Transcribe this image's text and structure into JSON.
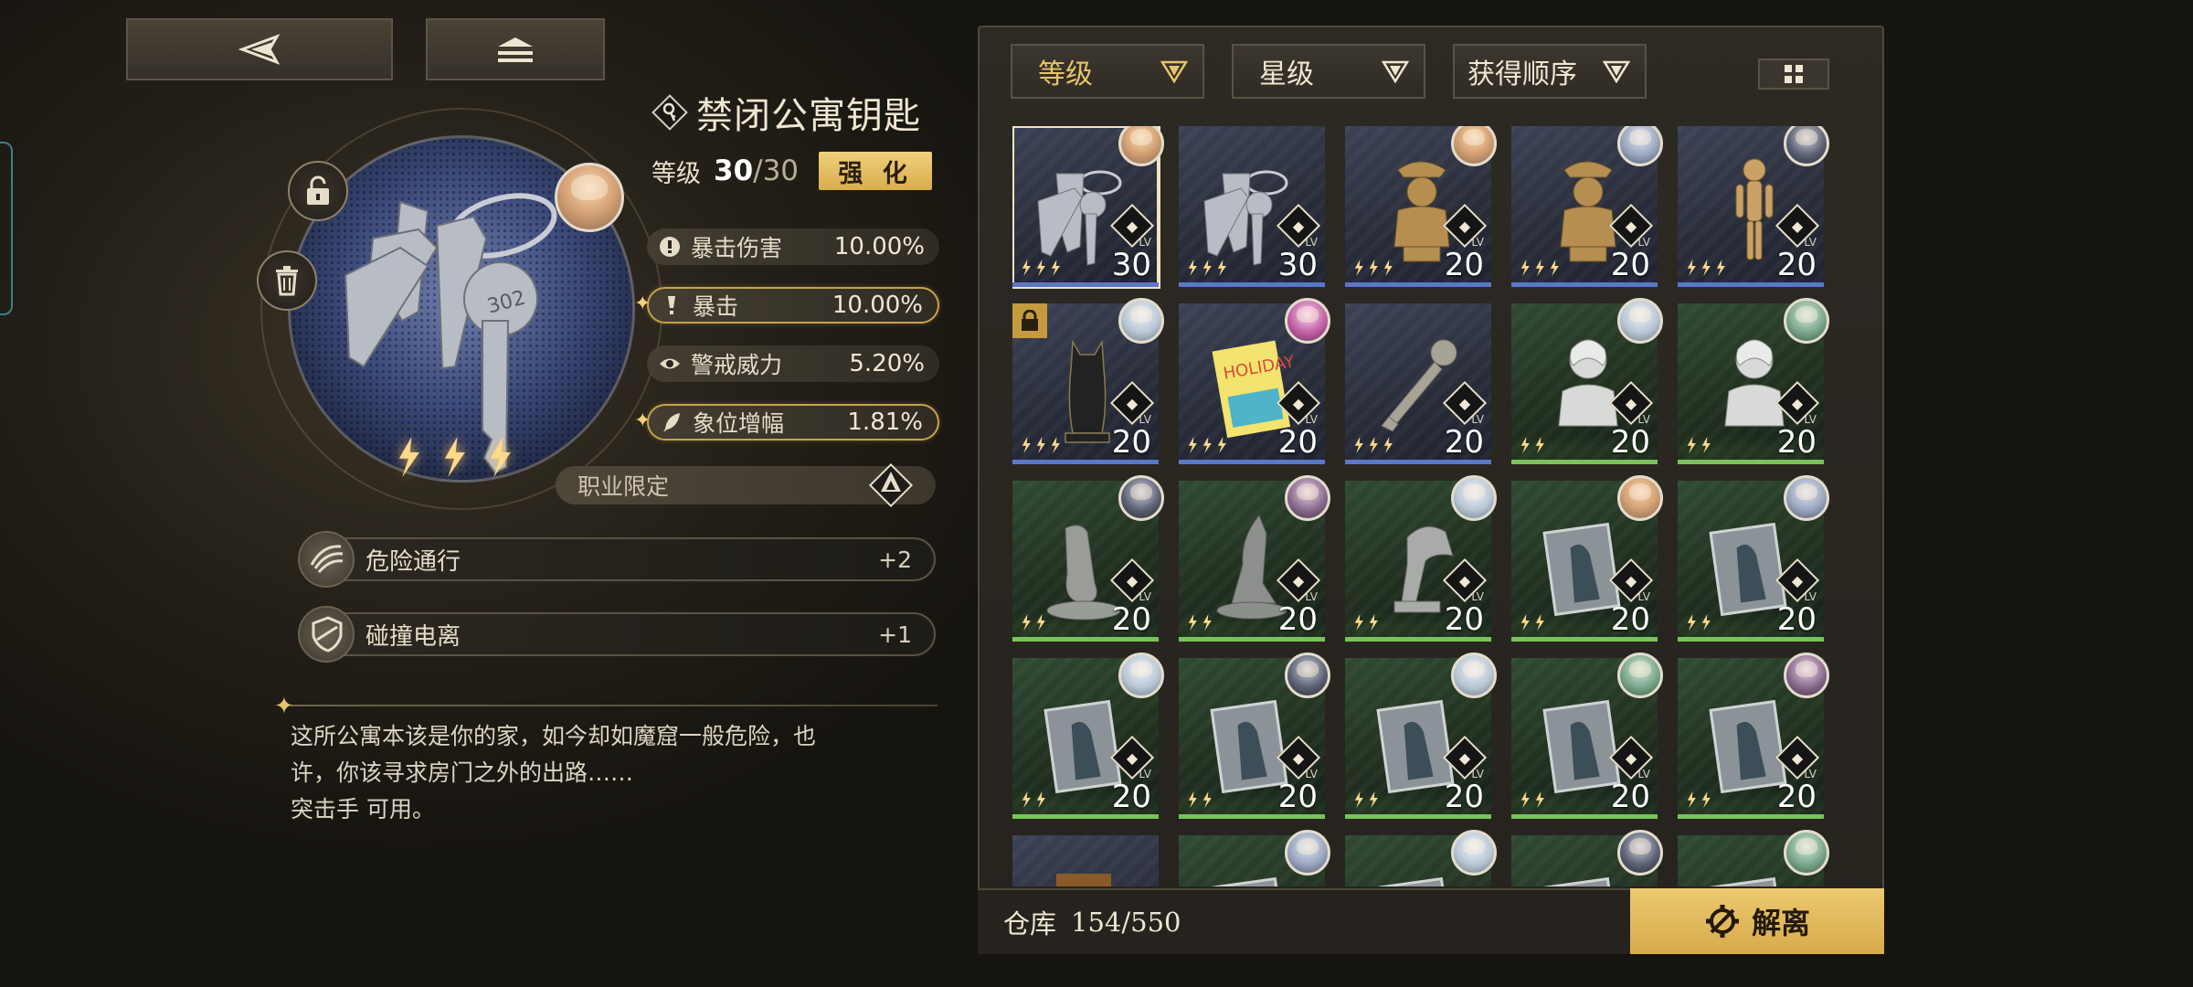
{
  "nav": {
    "back_icon": "back-arrow-icon",
    "home_icon": "stack-home-icon"
  },
  "item": {
    "name": "禁闭公寓钥匙",
    "level_label": "等级",
    "level": "30",
    "level_max": "/30",
    "enhance_label": "强 化",
    "rarity_stars": 3,
    "stats": [
      {
        "label": "暴击伤害",
        "value": "10.00%",
        "icon": "crit-damage-icon",
        "highlight": false
      },
      {
        "label": "暴击",
        "value": "10.00%",
        "icon": "crit-icon",
        "highlight": true
      },
      {
        "label": "警戒威力",
        "value": "5.20%",
        "icon": "alert-eye-icon",
        "highlight": false
      },
      {
        "label": "象位增幅",
        "value": "1.81%",
        "icon": "quill-icon",
        "highlight": true
      }
    ],
    "restriction_label": "职业限定",
    "skills": [
      {
        "name": "危险通行",
        "value": "+2"
      },
      {
        "name": "碰撞电离",
        "value": "+1"
      }
    ],
    "description": "这所公寓本该是你的家，如今却如魔窟一般危险，也\n许，你该寻求房门之外的出路……\n突击手 可用。"
  },
  "filters": [
    {
      "label": "等级",
      "active": true
    },
    {
      "label": "星级",
      "active": false
    },
    {
      "label": "获得顺序",
      "active": false
    }
  ],
  "inventory": {
    "lv_tag": "LV",
    "cards": [
      {
        "lv": "30",
        "stars": 3,
        "theme": "blue",
        "art": "keys",
        "avatar": "p1",
        "selected": true,
        "locked": false
      },
      {
        "lv": "30",
        "stars": 3,
        "theme": "blue",
        "art": "keys",
        "avatar": "",
        "selected": false,
        "locked": false
      },
      {
        "lv": "20",
        "stars": 3,
        "theme": "blue",
        "art": "bust-gold",
        "avatar": "p1",
        "selected": false,
        "locked": false
      },
      {
        "lv": "20",
        "stars": 3,
        "theme": "blue",
        "art": "bust-gold",
        "avatar": "p2",
        "selected": false,
        "locked": false
      },
      {
        "lv": "20",
        "stars": 3,
        "theme": "blue",
        "art": "mannequin",
        "avatar": "p6",
        "selected": false,
        "locked": false
      },
      {
        "lv": "20",
        "stars": 3,
        "theme": "blue",
        "art": "cat",
        "avatar": "p4",
        "selected": false,
        "locked": true
      },
      {
        "lv": "20",
        "stars": 3,
        "theme": "blue",
        "art": "book",
        "avatar": "p3",
        "selected": false,
        "locked": false
      },
      {
        "lv": "20",
        "stars": 3,
        "theme": "blue",
        "art": "key-ornate",
        "avatar": "",
        "selected": false,
        "locked": false
      },
      {
        "lv": "20",
        "stars": 2,
        "theme": "green",
        "art": "bust-white",
        "avatar": "p4",
        "selected": false,
        "locked": false
      },
      {
        "lv": "20",
        "stars": 2,
        "theme": "green",
        "art": "bust-white",
        "avatar": "p5",
        "selected": false,
        "locked": false
      },
      {
        "lv": "20",
        "stars": 2,
        "theme": "green",
        "art": "panther",
        "avatar": "p6",
        "selected": false,
        "locked": false
      },
      {
        "lv": "20",
        "stars": 2,
        "theme": "green",
        "art": "wolf",
        "avatar": "p7",
        "selected": false,
        "locked": false
      },
      {
        "lv": "20",
        "stars": 2,
        "theme": "green",
        "art": "eagle",
        "avatar": "p4",
        "selected": false,
        "locked": false
      },
      {
        "lv": "20",
        "stars": 2,
        "theme": "green",
        "art": "frame",
        "avatar": "p1",
        "selected": false,
        "locked": false
      },
      {
        "lv": "20",
        "stars": 2,
        "theme": "green",
        "art": "frame",
        "avatar": "p2",
        "selected": false,
        "locked": false
      },
      {
        "lv": "20",
        "stars": 2,
        "theme": "green",
        "art": "frame",
        "avatar": "p4",
        "selected": false,
        "locked": false
      },
      {
        "lv": "20",
        "stars": 2,
        "theme": "green",
        "art": "frame",
        "avatar": "p6",
        "selected": false,
        "locked": false
      },
      {
        "lv": "20",
        "stars": 2,
        "theme": "green",
        "art": "frame",
        "avatar": "p4",
        "selected": false,
        "locked": false
      },
      {
        "lv": "20",
        "stars": 2,
        "theme": "green",
        "art": "frame",
        "avatar": "p5",
        "selected": false,
        "locked": false
      },
      {
        "lv": "20",
        "stars": 2,
        "theme": "green",
        "art": "frame",
        "avatar": "p7",
        "selected": false,
        "locked": false
      },
      {
        "lv": "",
        "stars": 0,
        "theme": "blue",
        "art": "box",
        "avatar": "",
        "selected": false,
        "locked": false
      },
      {
        "lv": "",
        "stars": 0,
        "theme": "green",
        "art": "frame",
        "avatar": "p2",
        "selected": false,
        "locked": false
      },
      {
        "lv": "",
        "stars": 0,
        "theme": "green",
        "art": "frame",
        "avatar": "p4",
        "selected": false,
        "locked": false
      },
      {
        "lv": "",
        "stars": 0,
        "theme": "green",
        "art": "frame",
        "avatar": "p6",
        "selected": false,
        "locked": false
      },
      {
        "lv": "",
        "stars": 0,
        "theme": "green",
        "art": "frame",
        "avatar": "p5",
        "selected": false,
        "locked": false
      }
    ]
  },
  "storage": {
    "label": "仓库",
    "count": "154/550"
  },
  "dismantle_label": "解离",
  "colors": {
    "gold": "#e2b95c",
    "blue_rarity": "#5a78c8",
    "green_rarity": "#79c35a",
    "panel": "#2d2923"
  }
}
